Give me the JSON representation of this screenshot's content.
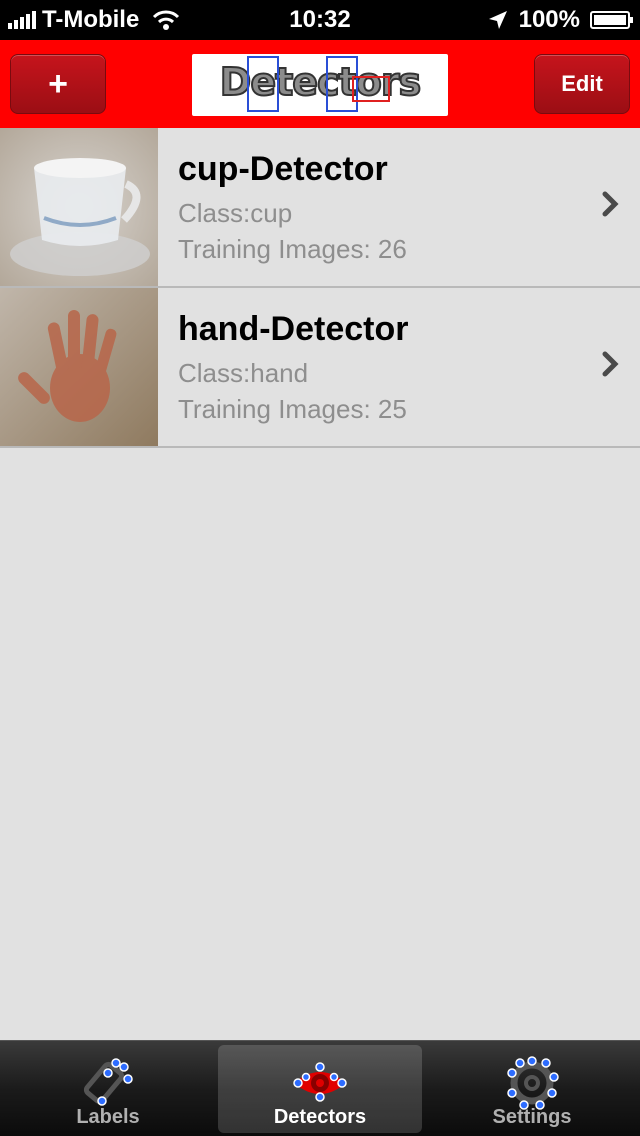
{
  "status_bar": {
    "carrier": "T-Mobile",
    "time": "10:32",
    "battery": "100%",
    "icons": [
      "signal-bars-icon",
      "wifi-icon",
      "location-arrow-icon",
      "battery-icon"
    ]
  },
  "nav_bar": {
    "add_label": "+",
    "edit_label": "Edit",
    "title": "Detectors",
    "background_color": "#ff0000",
    "button_color": "#b3111a"
  },
  "detectors": [
    {
      "name": "cup-Detector",
      "class_text": "Class:cup",
      "training_text": "Training Images: 26",
      "thumbnail": "cup-thumbnail"
    },
    {
      "name": "hand-Detector",
      "class_text": "Class:hand",
      "training_text": "Training Images: 25",
      "thumbnail": "hand-thumbnail"
    }
  ],
  "tab_bar": {
    "tabs": [
      {
        "label": "Labels",
        "icon": "tag-icon"
      },
      {
        "label": "Detectors",
        "icon": "eye-icon"
      },
      {
        "label": "Settings",
        "icon": "gear-icon"
      }
    ],
    "selected": "Detectors"
  }
}
